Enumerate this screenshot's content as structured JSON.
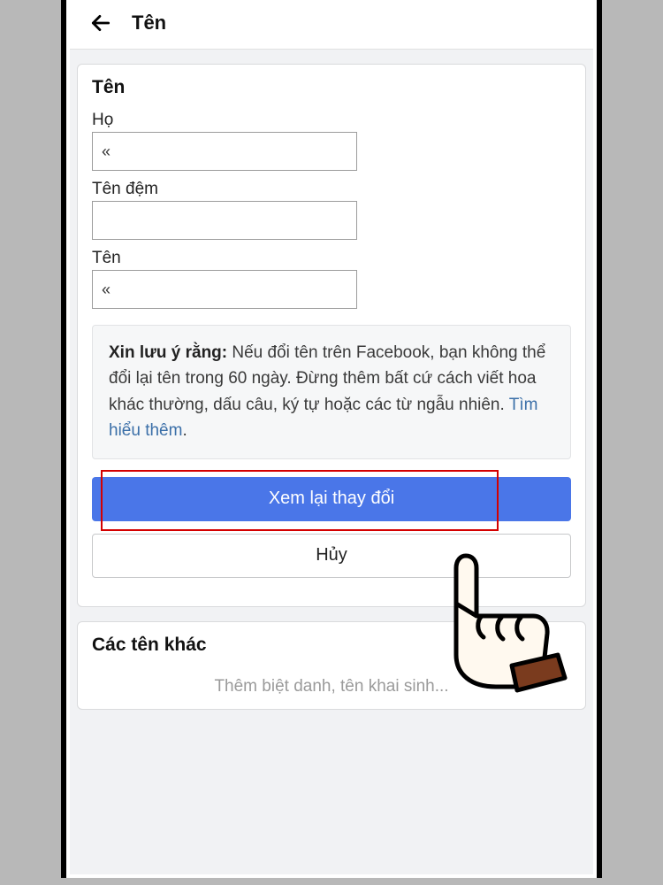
{
  "header": {
    "title": "Tên"
  },
  "card": {
    "title": "Tên",
    "fields": {
      "lastName": {
        "label": "Họ",
        "value": "«"
      },
      "middleName": {
        "label": "Tên đệm",
        "value": ""
      },
      "firstName": {
        "label": "Tên",
        "value": "«"
      }
    },
    "notice": {
      "bold": "Xin lưu ý rằng:",
      "text": " Nếu đổi tên trên Facebook, bạn không thể đổi lại tên trong 60 ngày. Đừng thêm bất cứ cách viết hoa khác thường, dấu câu, ký tự hoặc các từ ngẫu nhiên. ",
      "link": "Tìm hiểu thêm",
      "period": "."
    },
    "primaryButton": "Xem lại thay đổi",
    "secondaryButton": "Hủy"
  },
  "otherNames": {
    "title": "Các tên khác",
    "addLabel": "Thêm biệt danh, tên khai sinh..."
  }
}
